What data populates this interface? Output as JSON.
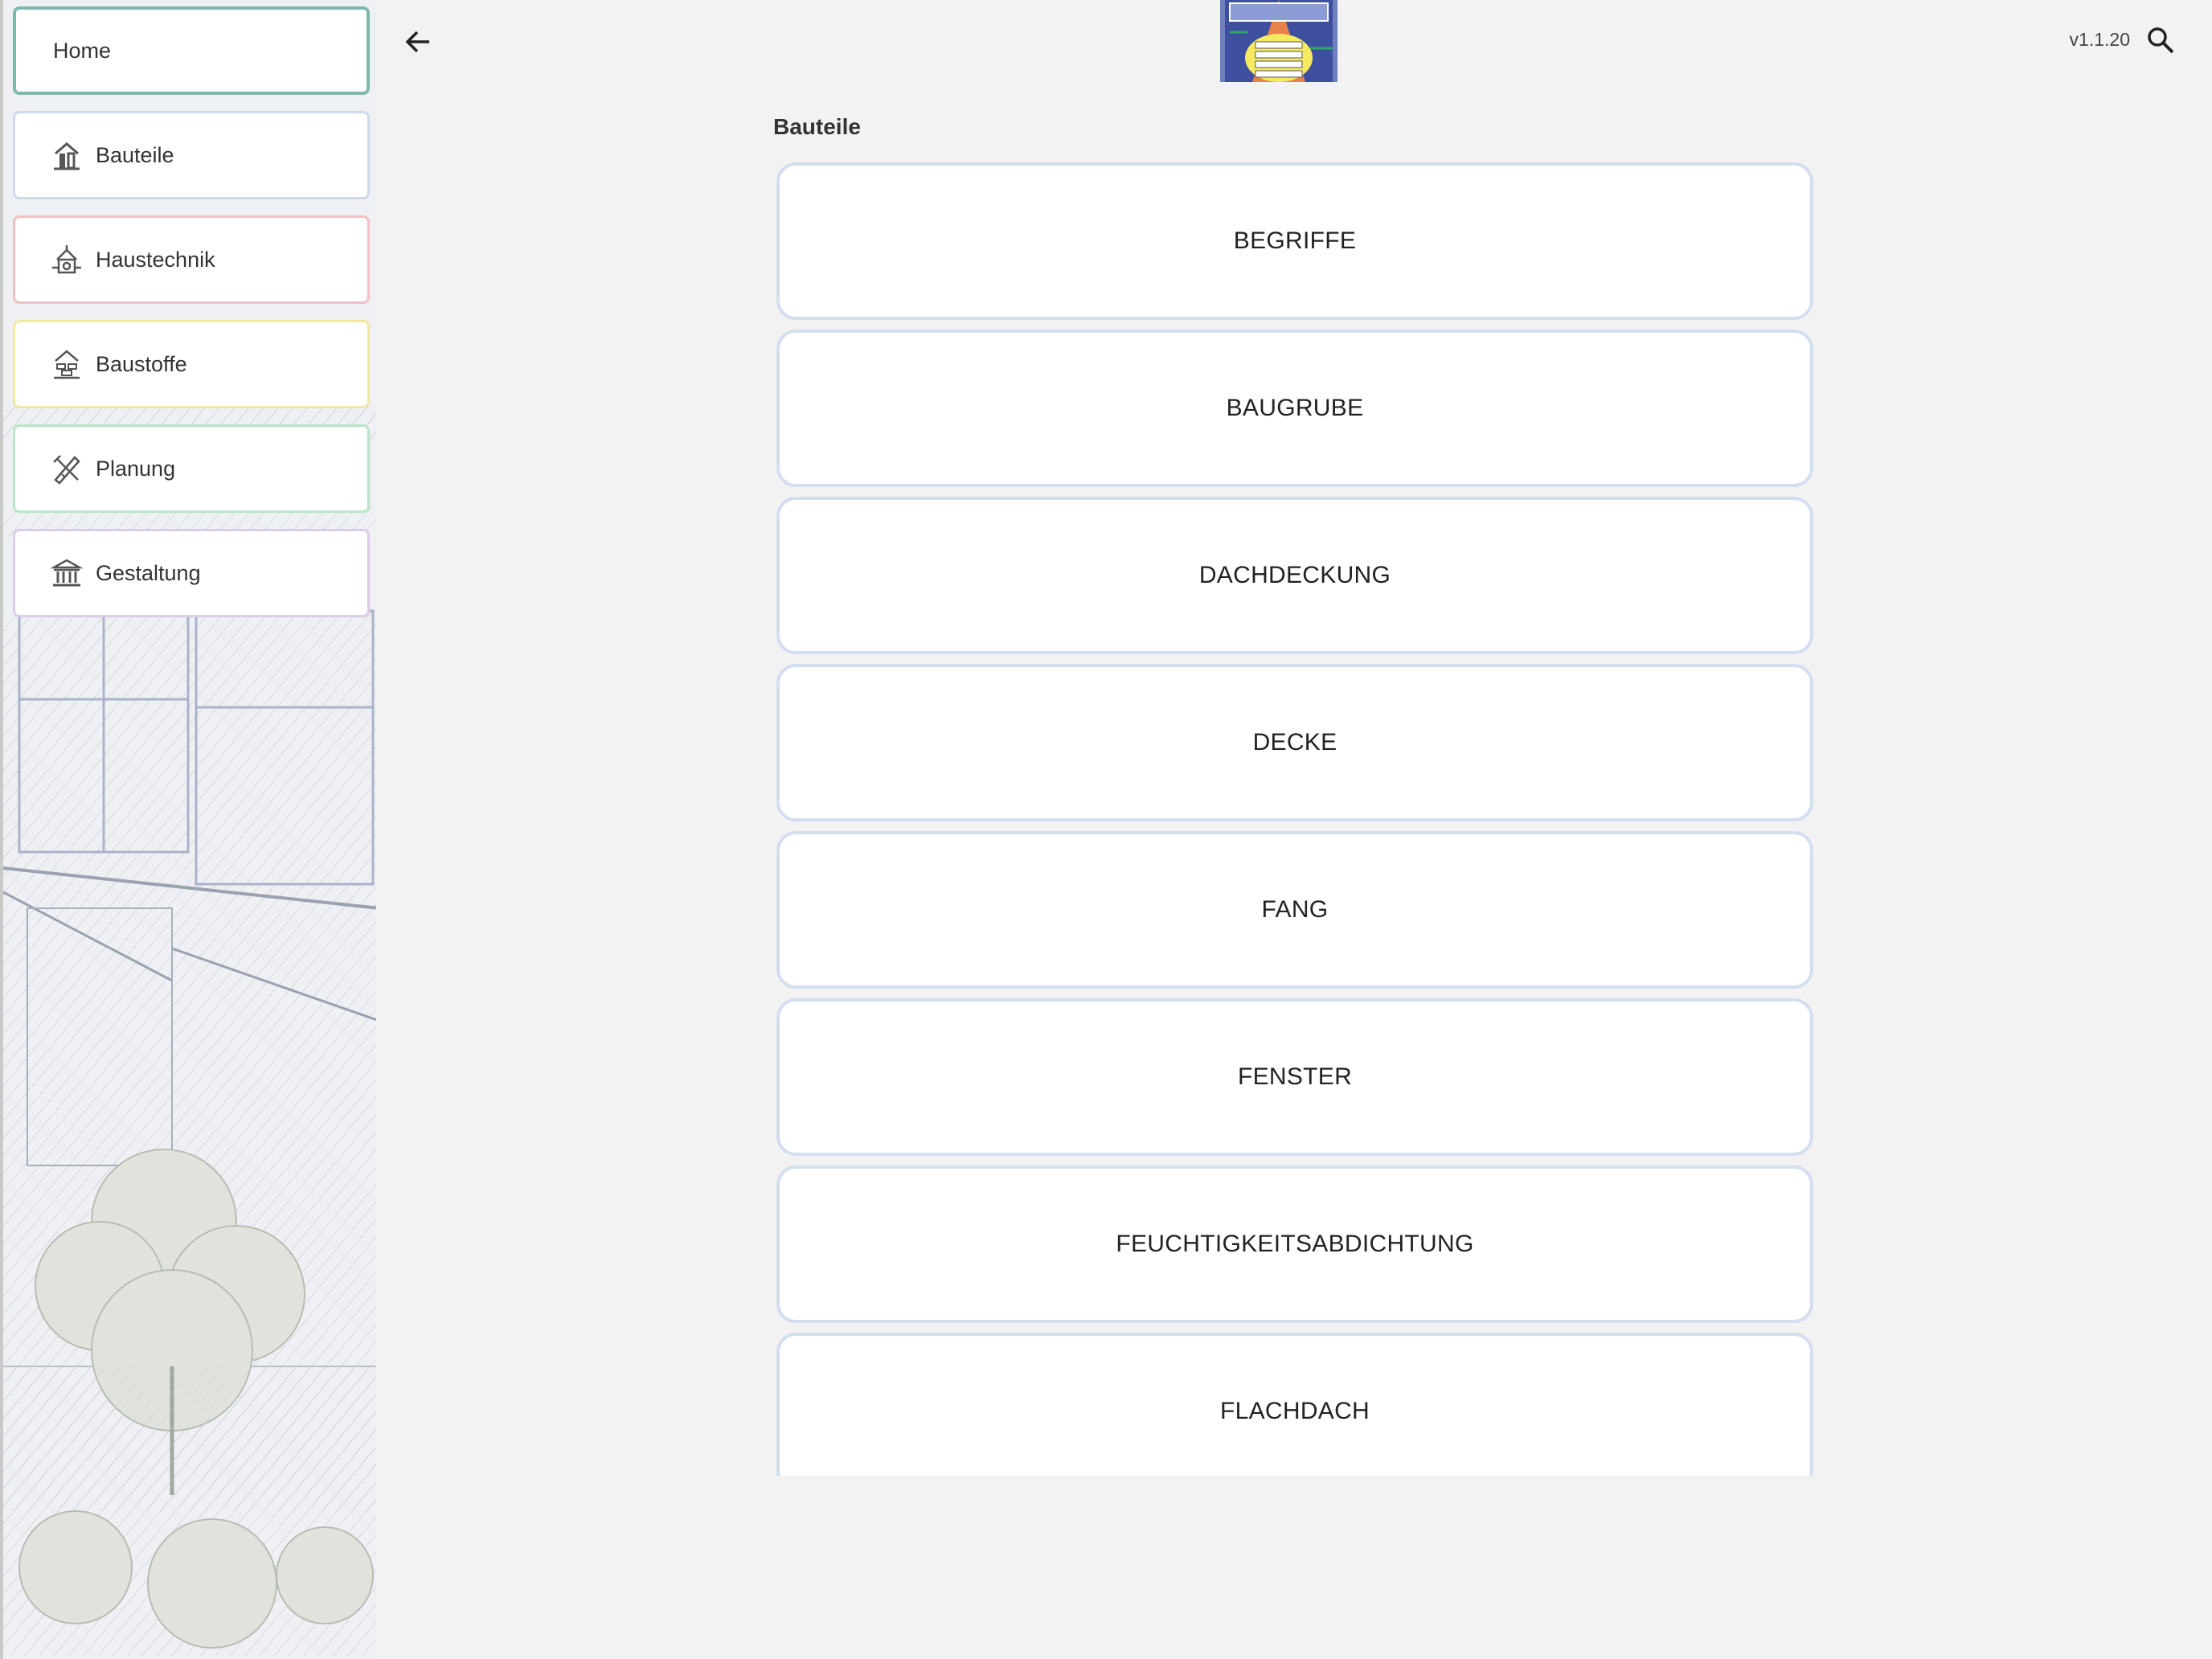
{
  "sidebar": {
    "items": [
      {
        "label": "Home",
        "icon": "home"
      },
      {
        "label": "Bauteile",
        "icon": "building-part-icon"
      },
      {
        "label": "Haustechnik",
        "icon": "building-services-icon"
      },
      {
        "label": "Baustoffe",
        "icon": "building-materials-icon"
      },
      {
        "label": "Planung",
        "icon": "planning-tools-icon"
      },
      {
        "label": "Gestaltung",
        "icon": "column-building-icon"
      }
    ]
  },
  "header": {
    "back_icon": "arrow-left-icon",
    "logo": "app-logo",
    "version": "v1.1.20",
    "search_icon": "search-icon"
  },
  "main": {
    "title": "Bauteile",
    "items": [
      "BEGRIFFE",
      "BAUGRUBE",
      "DACHDECKUNG",
      "DECKE",
      "FANG",
      "FENSTER",
      "FEUCHTIGKEITSABDICHTUNG",
      "FLACHDACH"
    ]
  },
  "colors": {
    "background": "#f2f2f2",
    "card_border": "#d3deef",
    "home_border": "#7fb9ad",
    "bauteile_border": "#cfd8ea",
    "haustechnik_border": "#f0c0c4",
    "baustoffe_border": "#f3e7a6",
    "planung_border": "#b9e5c8",
    "gestaltung_border": "#dccbe9"
  }
}
